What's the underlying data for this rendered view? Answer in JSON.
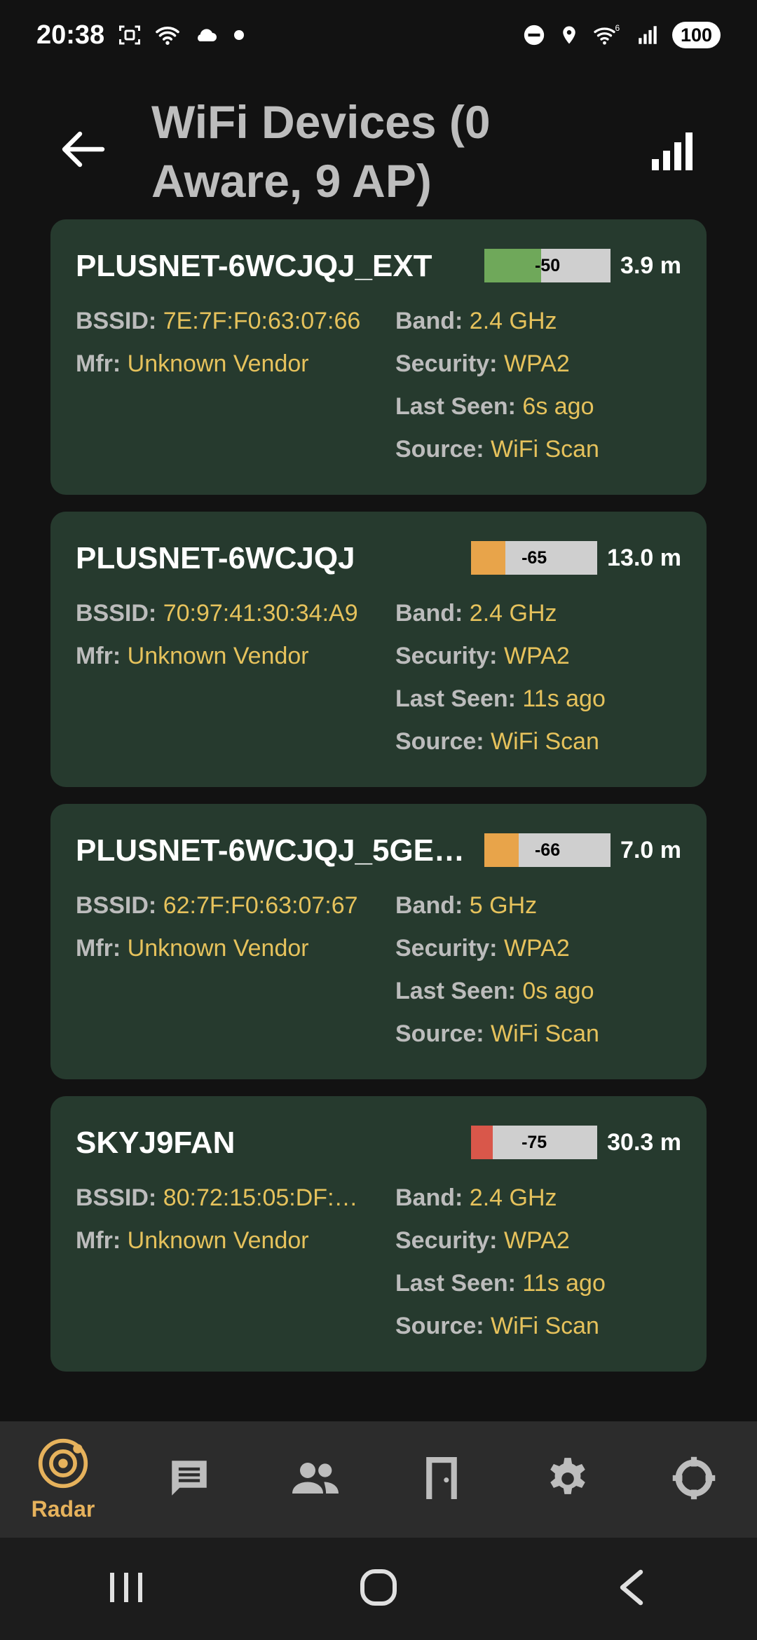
{
  "status_bar": {
    "time": "20:38",
    "battery": "100",
    "icons_left": [
      "screenshot-icon",
      "wifi-icon",
      "cloud-icon",
      "dot-icon"
    ],
    "icons_right": [
      "dnd-icon",
      "location-icon",
      "wifi-6-icon",
      "cell-signal-icon"
    ]
  },
  "app_bar": {
    "title": "WiFi Devices (0 Aware, 9 AP)",
    "back_icon": "arrow-left-icon",
    "action_icon": "signal-bars-icon"
  },
  "labels": {
    "bssid": "BSSID:",
    "mfr": "Mfr:",
    "band": "Band:",
    "security": "Security:",
    "last_seen": "Last Seen:",
    "source": "Source:"
  },
  "devices": [
    {
      "name": "PLUSNET-6WCJQJ_EXT",
      "rssi": "-50",
      "strength": 0.45,
      "color": "#6fa85a",
      "distance": "3.9 m",
      "bssid": "7E:7F:F0:63:07:66",
      "mfr": "Unknown Vendor",
      "band": "2.4 GHz",
      "security": "WPA2",
      "last_seen": "6s ago",
      "source": "WiFi Scan"
    },
    {
      "name": "PLUSNET-6WCJQJ",
      "rssi": "-65",
      "strength": 0.27,
      "color": "#e8a44a",
      "distance": "13.0 m",
      "bssid": "70:97:41:30:34:A9",
      "mfr": "Unknown Vendor",
      "band": "2.4 GHz",
      "security": "WPA2",
      "last_seen": "11s ago",
      "source": "WiFi Scan"
    },
    {
      "name": "PLUSNET-6WCJQJ_5GE…",
      "rssi": "-66",
      "strength": 0.27,
      "color": "#e8a44a",
      "distance": "7.0 m",
      "bssid": "62:7F:F0:63:07:67",
      "mfr": "Unknown Vendor",
      "band": "5 GHz",
      "security": "WPA2",
      "last_seen": "0s ago",
      "source": "WiFi Scan"
    },
    {
      "name": "SKYJ9FAN",
      "rssi": "-75",
      "strength": 0.17,
      "color": "#d9574a",
      "distance": "30.3 m",
      "bssid": "80:72:15:05:DF:…",
      "mfr": "Unknown Vendor",
      "band": "2.4 GHz",
      "security": "WPA2",
      "last_seen": "11s ago",
      "source": "WiFi Scan"
    }
  ],
  "bottom_nav": [
    {
      "icon": "radar-icon",
      "label": "Radar",
      "active": true
    },
    {
      "icon": "chat-icon",
      "label": ""
    },
    {
      "icon": "people-icon",
      "label": ""
    },
    {
      "icon": "door-icon",
      "label": ""
    },
    {
      "icon": "settings-gear-icon",
      "label": ""
    },
    {
      "icon": "crosshair-icon",
      "label": ""
    }
  ],
  "colors": {
    "background": "#121212",
    "card": "#263a2e",
    "value_text": "#e6c25c",
    "active_nav": "#e6b25c"
  }
}
